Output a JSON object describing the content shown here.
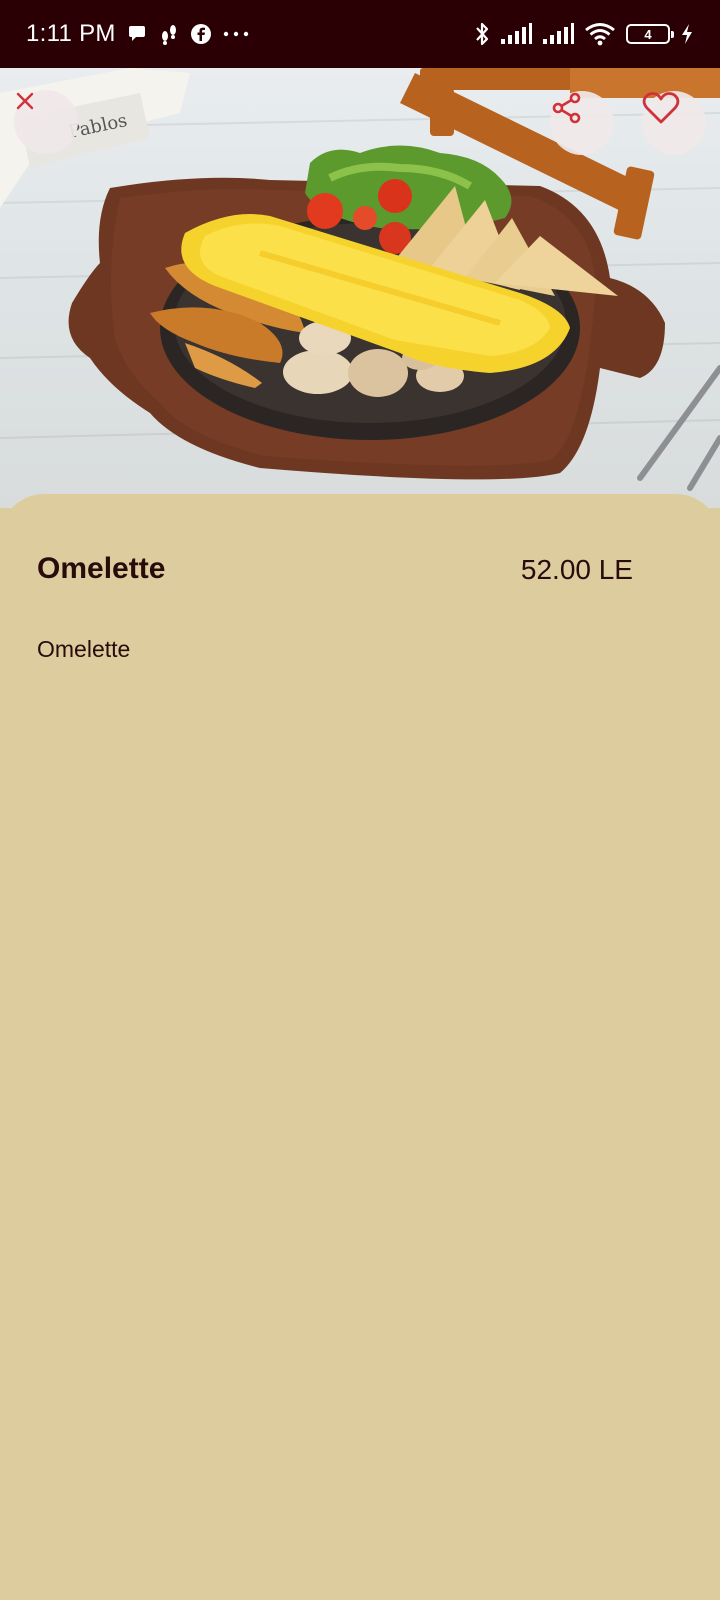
{
  "status_bar": {
    "time": "1:11 PM",
    "notification_icons": [
      "chat-bubble-icon",
      "steps-icon",
      "facebook-icon",
      "more-dots-icon"
    ],
    "system_icons": [
      "bluetooth-icon",
      "signal-icon",
      "signal-icon",
      "wifi-icon",
      "battery-icon",
      "charging-icon"
    ],
    "battery_level": "4"
  },
  "hero": {
    "image": "omelette-dish-photo",
    "close_icon": "close-icon",
    "share_icon": "share-icon",
    "favorite_icon": "heart-icon"
  },
  "product": {
    "name": "Omelette",
    "price": "52.00 LE",
    "description": "Omelette"
  },
  "colors": {
    "status_bar_bg": "#2A0004",
    "sheet_bg": "#DDCD9E",
    "text": "#2A0B0B",
    "accent": "#D0323A"
  }
}
